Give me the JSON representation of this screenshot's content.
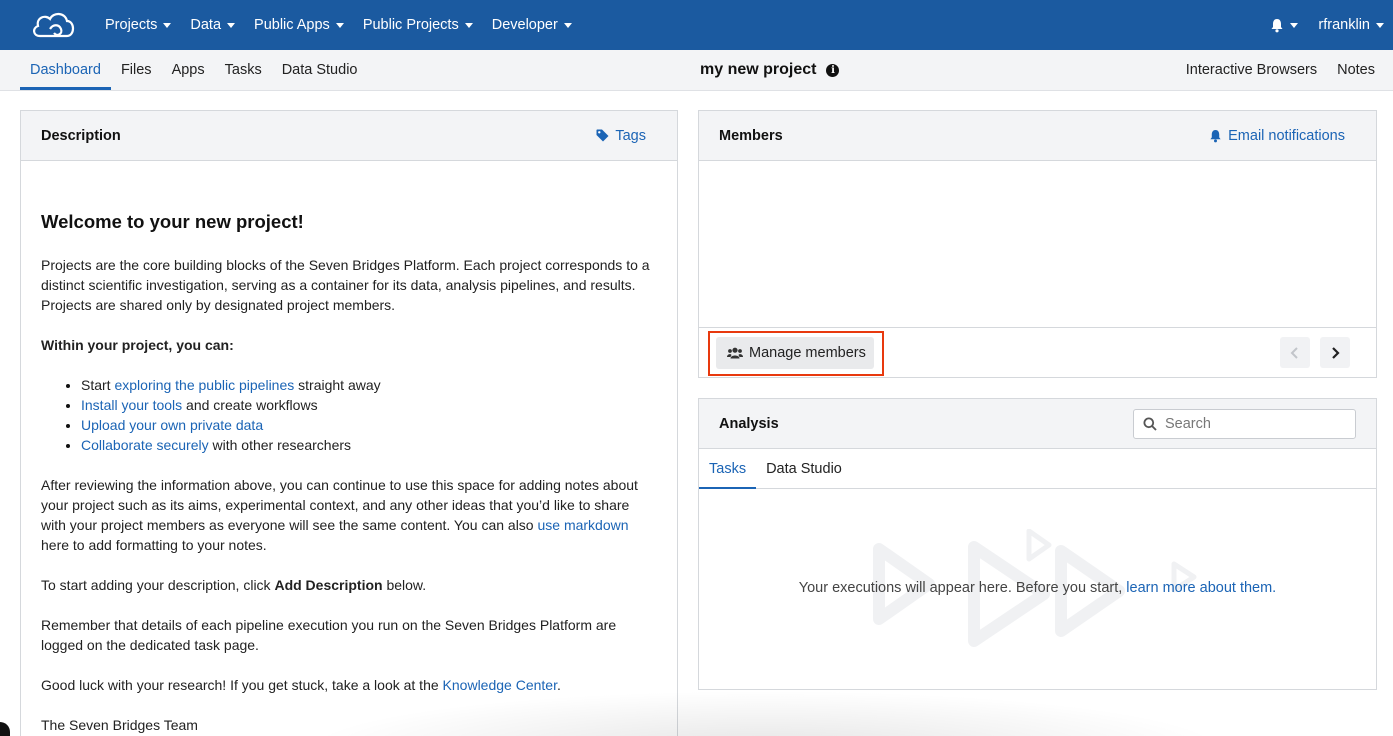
{
  "topnav": {
    "logo": "cloud-logo-icon",
    "menu": [
      {
        "label": "Projects"
      },
      {
        "label": "Data"
      },
      {
        "label": "Public Apps"
      },
      {
        "label": "Public Projects"
      },
      {
        "label": "Developer"
      }
    ],
    "notifications_icon": "bell-icon",
    "username": "rfranklin"
  },
  "subnav": {
    "tabs": [
      {
        "label": "Dashboard",
        "active": true
      },
      {
        "label": "Files"
      },
      {
        "label": "Apps"
      },
      {
        "label": "Tasks"
      },
      {
        "label": "Data Studio"
      }
    ],
    "project_title": "my new project",
    "right_links": [
      "Interactive Browsers",
      "Notes"
    ]
  },
  "description": {
    "title": "Description",
    "tags_label": "Tags",
    "heading": "Welcome to your new project!",
    "intro": "Projects are the core building blocks of the Seven Bridges Platform. Each project corresponds to a distinct scientific investigation, serving as a container for its data, analysis pipelines, and results. Projects are shared only by designated project members.",
    "within_heading": "Within your project, you can:",
    "bullets": [
      {
        "pre": "Start ",
        "link": "exploring the public pipelines",
        "post": " straight away"
      },
      {
        "pre": "",
        "link": "Install your tools",
        "post": " and create workflows"
      },
      {
        "pre": "",
        "link": "Upload your own private data",
        "post": ""
      },
      {
        "pre": "",
        "link": "Collaborate securely",
        "post": " with other researchers"
      }
    ],
    "after_pre": "After reviewing the information above, you can continue to use this space for adding notes about your project such as its aims, experimental context, and any other ideas that you’d like to share with your project members as everyone will see the same content. You can also ",
    "after_link": "use markdown",
    "after_post": " here to add formatting to your notes.",
    "start_pre": "To start adding your description, click ",
    "start_bold": "Add Description",
    "start_post": " below.",
    "remember": "Remember that details of each pipeline execution you run on the Seven Bridges Platform are logged on the dedicated task page.",
    "luck_pre": "Good luck with your research! If you get stuck, take a look at the ",
    "luck_link": "Knowledge Center",
    "luck_post": ".",
    "signoff": "The Seven Bridges Team"
  },
  "members": {
    "title": "Members",
    "email_label": "Email notifications",
    "manage_label": "Manage members"
  },
  "analysis": {
    "title": "Analysis",
    "search_placeholder": "Search",
    "tabs": [
      {
        "label": "Tasks",
        "active": true
      },
      {
        "label": "Data Studio"
      }
    ],
    "empty_pre": "Your executions will appear here. Before you start, ",
    "empty_link": "learn more about them."
  },
  "colors": {
    "nav_bg": "#1b5aa0",
    "link": "#1b64b5",
    "highlight_border": "#e8390e"
  }
}
